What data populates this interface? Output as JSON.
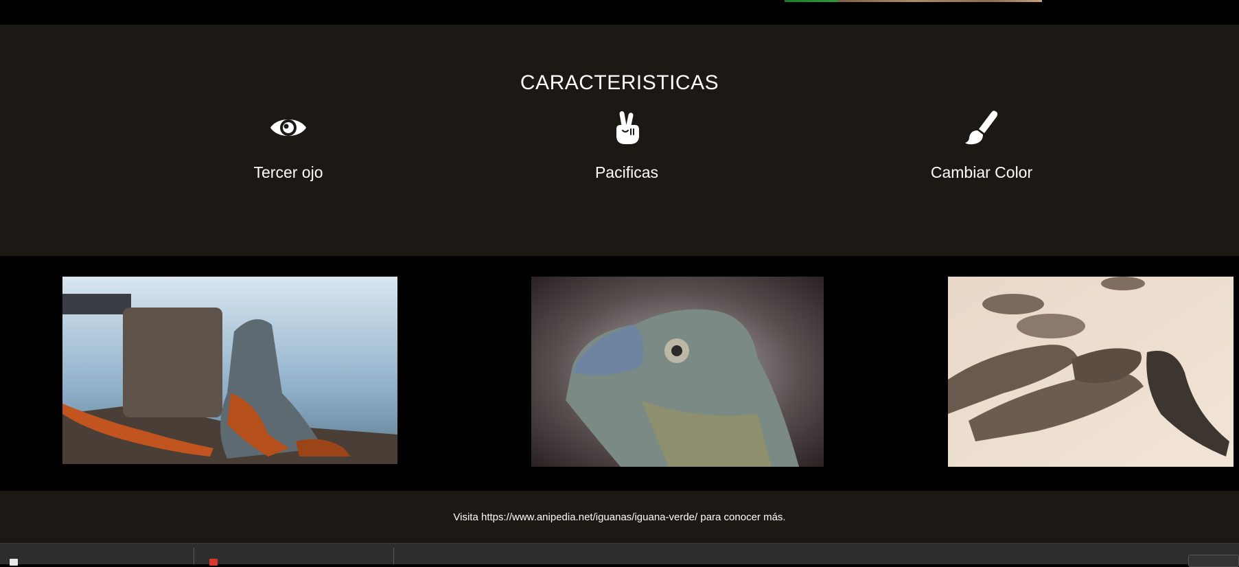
{
  "features": {
    "title": "CARACTERISTICAS",
    "items": [
      {
        "icon": "eye-icon",
        "label": "Tercer ojo"
      },
      {
        "icon": "peace-hand-icon",
        "label": "Pacificas"
      },
      {
        "icon": "paint-brush-icon",
        "label": "Cambiar Color"
      }
    ]
  },
  "gallery": {
    "images": [
      {
        "subject": "iguana-on-rocks-by-water"
      },
      {
        "subject": "iguana-head-closeup"
      },
      {
        "subject": "iguanas-on-beach"
      }
    ]
  },
  "footer": {
    "text": "Visita https://www.anipedia.net/iguanas/iguana-verde/ para conocer más."
  },
  "downloads_bar": {
    "items": [
      {
        "icon": "file-icon",
        "label": ""
      },
      {
        "icon": "pdf-file-icon",
        "label": ""
      }
    ]
  },
  "colors": {
    "section_bg": "#1c1813",
    "page_bg": "#000000",
    "text": "#ffffff"
  }
}
